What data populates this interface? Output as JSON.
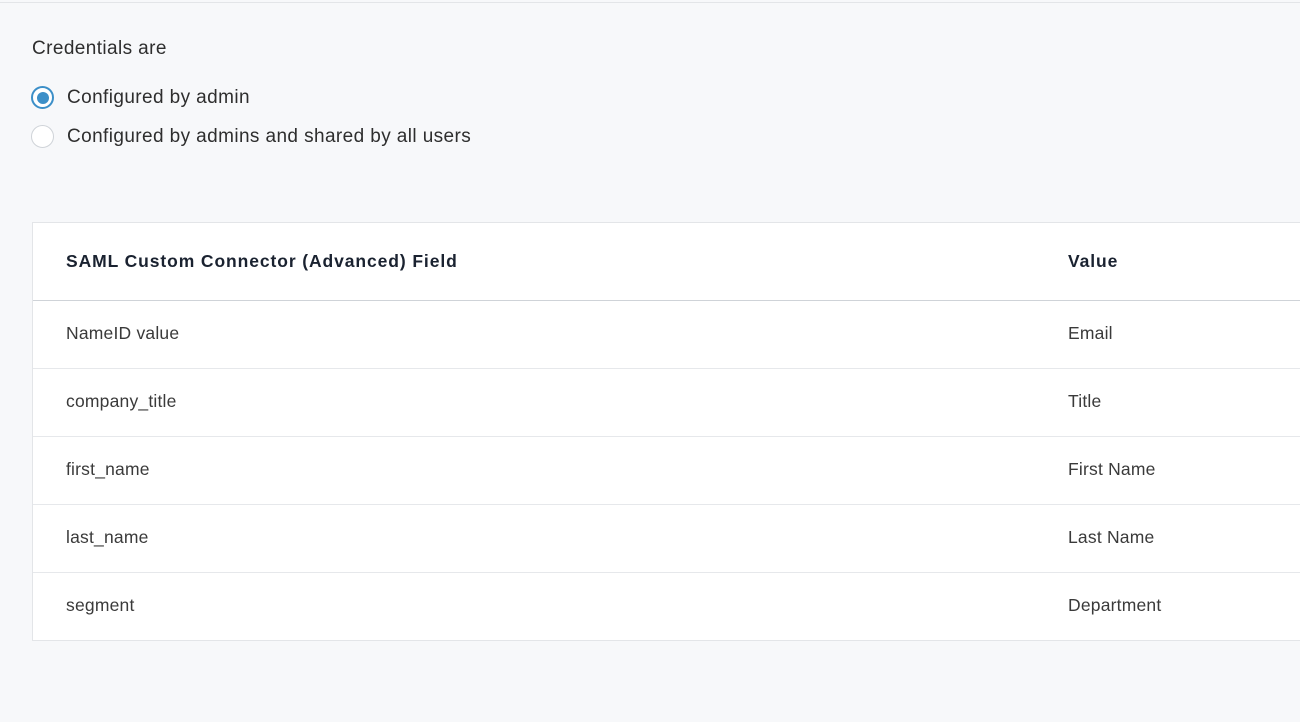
{
  "credentials": {
    "label": "Credentials are",
    "options": [
      {
        "label": "Configured by admin",
        "selected": true
      },
      {
        "label": "Configured by admins and shared by all users",
        "selected": false
      }
    ]
  },
  "table": {
    "headers": {
      "field": "SAML Custom Connector (Advanced) Field",
      "value": "Value"
    },
    "rows": [
      {
        "field": "NameID value",
        "value": "Email"
      },
      {
        "field": "company_title",
        "value": "Title"
      },
      {
        "field": "first_name",
        "value": "First Name"
      },
      {
        "field": "last_name",
        "value": "Last Name"
      },
      {
        "field": "segment",
        "value": "Department"
      }
    ]
  },
  "colors": {
    "accent": "#3c8fc8",
    "background": "#f7f8fa"
  }
}
